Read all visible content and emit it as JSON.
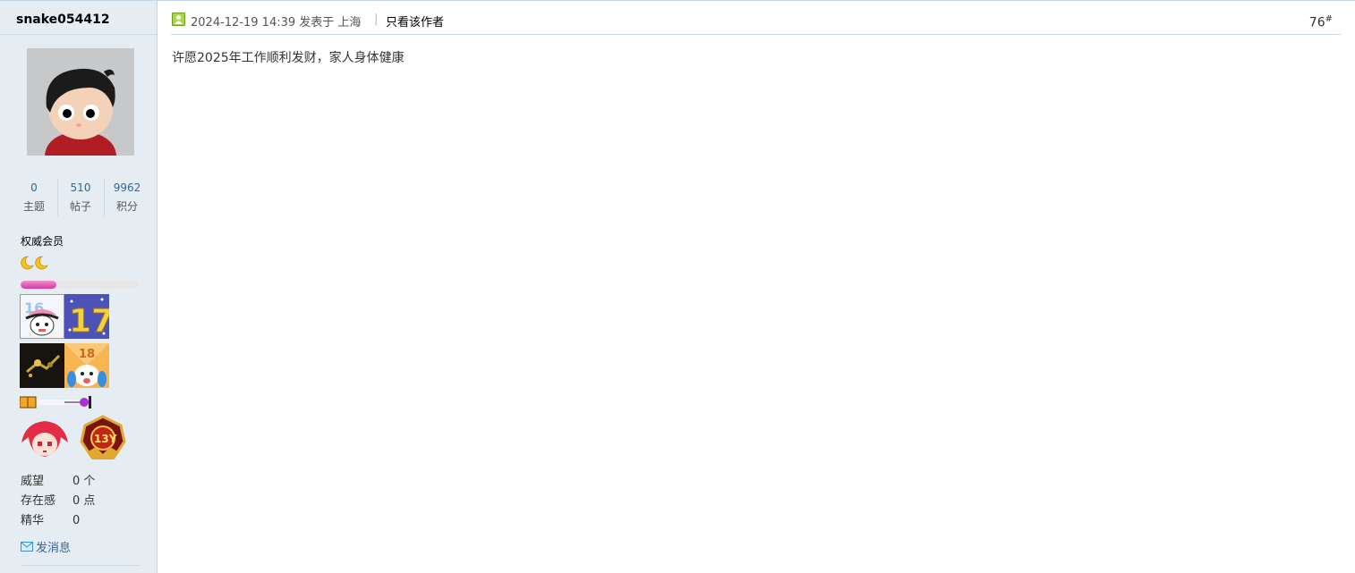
{
  "author": {
    "name": "snake054412",
    "stats": [
      {
        "num": "0",
        "label": "主题"
      },
      {
        "num": "510",
        "label": "帖子"
      },
      {
        "num": "9962",
        "label": "积分"
      }
    ],
    "group": "权威会员",
    "level_progress": 0.3,
    "info": [
      {
        "key": "威望",
        "value": "0 个"
      },
      {
        "key": "存在感",
        "value": "0 点"
      },
      {
        "key": "精华",
        "value": "0"
      }
    ],
    "send_message_label": "发消息"
  },
  "post": {
    "time_text": "2024-12-19 14:39 发表于 上海",
    "separator": "|",
    "only_author_label": "只看该作者",
    "floor_number": "76",
    "floor_suffix": "#",
    "content": "许愿2025年工作顺利发财，家人身体健康"
  },
  "colors": {
    "sidebar_bg": "#e5edf2",
    "link_blue": "#336699",
    "divider": "#c2d5e3",
    "progress_fill": "#d23aa1"
  },
  "icons": [
    "online-user-icon",
    "moon-icon",
    "envelope-icon"
  ]
}
